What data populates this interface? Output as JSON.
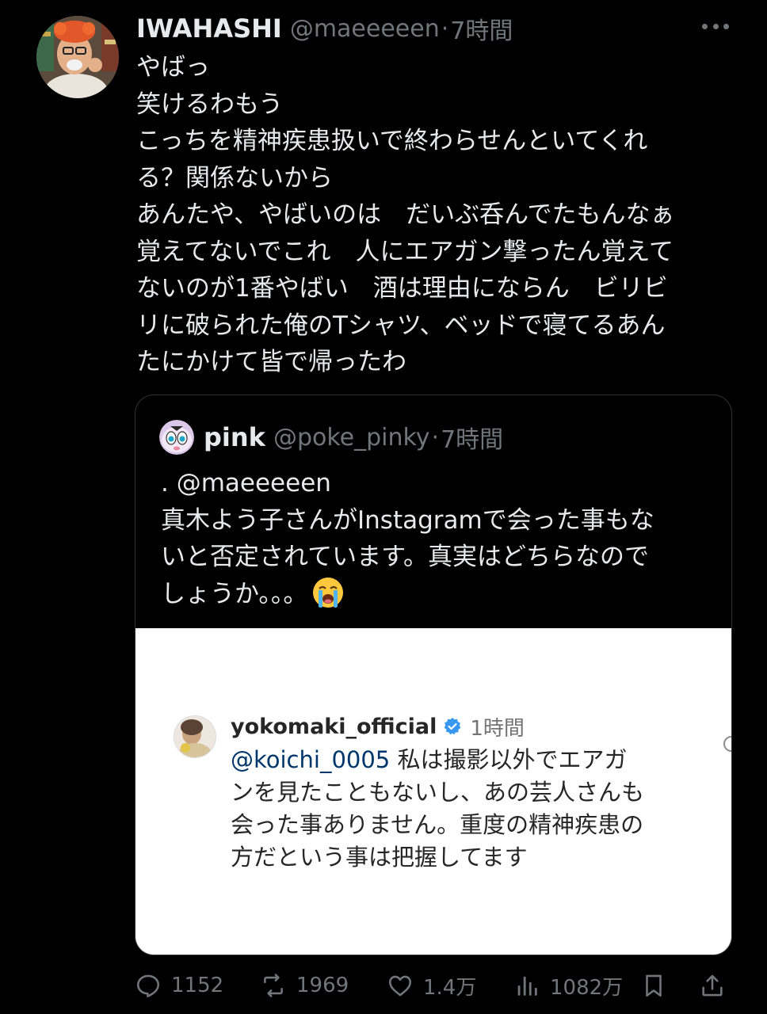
{
  "post": {
    "author_name": "IWAHASHI",
    "handle": "@maeeeeen",
    "separator": "·",
    "time": "7時間",
    "lines": [
      "やばっ",
      "笑けるわもう",
      "こっちを精神疾患扱いで終わらせんといてくれ",
      "る？関係ないから",
      "あんたや、やばいのは　だいぶ呑んでたもんなぁ",
      "覚えてないでこれ　人にエアガン撃ったん覚えて",
      "ないのが1番やばい　酒は理由にならん　ビリビ",
      "リに破られた俺のTシャツ、ベッドで寝てるあん",
      "たにかけて皆で帰ったわ"
    ]
  },
  "quote": {
    "author_name": "pink",
    "handle": "@poke_pinky",
    "separator": "·",
    "time": "7時間",
    "lines": [
      ". @maeeeeen",
      "真木よう子さんがInstagramで会った事もな",
      "いと否定されています。真実はどちらなので",
      "しょうか。。。"
    ],
    "emoji": "loudly-crying-face"
  },
  "instagram_comment": {
    "username": "yokomaki_official",
    "time": "1時間",
    "mention": "@koichi_0005",
    "first_line_rest": " 私は撮影以外でエアガ",
    "lines": [
      "ンを見たこともないし、あの芸人さんも",
      "会った事ありません。重度の精神疾患の",
      "方だという事は把握してます"
    ],
    "verified_color": "#3897f0"
  },
  "actions": {
    "replies": "1152",
    "reposts": "1969",
    "likes": "1.4万",
    "views": "1082万"
  },
  "colors": {
    "background": "#000000",
    "text": "#e7e9ea",
    "muted": "#71767b",
    "border": "#2f3336"
  }
}
